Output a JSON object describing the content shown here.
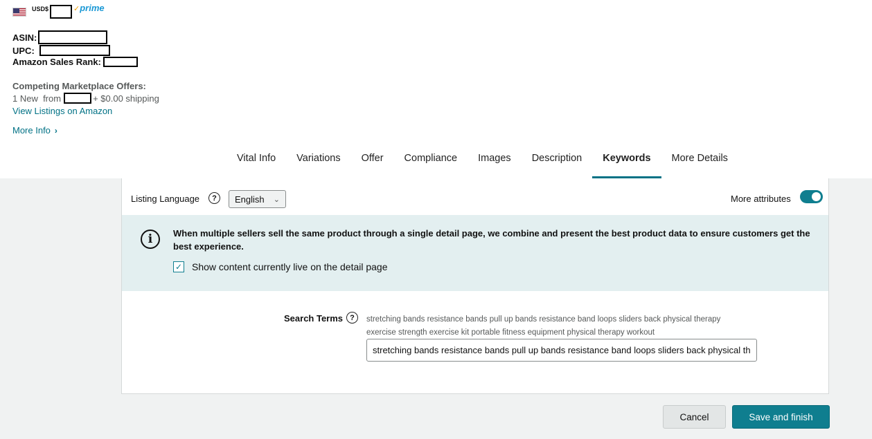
{
  "product": {
    "currency": "USD$",
    "prime_label": "prime",
    "asin_label": "ASIN:",
    "upc_label": "UPC:",
    "sales_rank_label": "Amazon Sales Rank:",
    "competing_title": "Competing Marketplace Offers:",
    "offers_count_text": "1 New  from",
    "shipping_text": "+ $0.00 shipping",
    "view_listings": "View Listings on Amazon",
    "more_info": "More Info"
  },
  "tabs": [
    {
      "label": "Vital Info"
    },
    {
      "label": "Variations"
    },
    {
      "label": "Offer"
    },
    {
      "label": "Compliance"
    },
    {
      "label": "Images"
    },
    {
      "label": "Description"
    },
    {
      "label": "Keywords",
      "active": true
    },
    {
      "label": "More Details"
    }
  ],
  "panel": {
    "listing_language_label": "Listing Language",
    "language_value": "English",
    "more_attributes_label": "More attributes",
    "more_attributes_on": true,
    "info_text": "When multiple sellers sell the same product through a single detail page, we combine and present the best product data to ensure customers get the best experience.",
    "show_live_label": "Show content currently live on the detail page",
    "show_live_checked": true,
    "search_terms_label": "Search Terms",
    "search_terms_hint": "stretching bands resistance bands pull up bands resistance band loops sliders back physical therapy exercise strength exercise kit portable fitness equipment physical therapy workout",
    "search_terms_value": "stretching bands resistance bands pull up bands resistance band loops sliders back physical therapy exercise strength exercise kit portable fitness equipment physical therapy workout"
  },
  "footer": {
    "cancel_label": "Cancel",
    "save_label": "Save and finish"
  },
  "colors": {
    "accent": "#0f7e8f",
    "link": "#007185",
    "info_bg": "#e3eff0"
  }
}
